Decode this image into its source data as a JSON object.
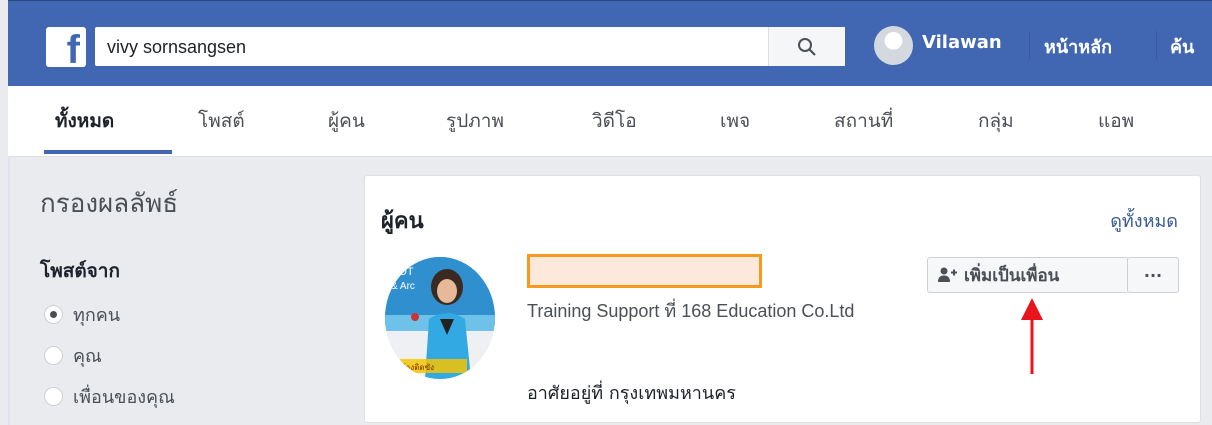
{
  "header": {
    "logo_letter": "f",
    "search_value": "vivy sornsangsen",
    "user_name": "Vilawan",
    "home_label": "หน้าหลัก",
    "find_label": "ค้น"
  },
  "tabs": [
    {
      "label": "ทั้งหมด",
      "active": true
    },
    {
      "label": "โพสต์"
    },
    {
      "label": "ผู้คน"
    },
    {
      "label": "รูปภาพ"
    },
    {
      "label": "วิดีโอ"
    },
    {
      "label": "เพจ"
    },
    {
      "label": "สถานที่"
    },
    {
      "label": "กลุ่ม"
    },
    {
      "label": "แอพ"
    }
  ],
  "filters": {
    "title": "กรองผลลัพธ์",
    "posts_from": "โพสต์จาก",
    "options": [
      {
        "label": "ทุกคน",
        "checked": true
      },
      {
        "label": "คุณ",
        "checked": false
      },
      {
        "label": "เพื่อนของคุณ",
        "checked": false
      }
    ]
  },
  "people_card": {
    "title": "ผู้คน",
    "see_all": "ดูทั้งหมด",
    "job": "Training Support ที่ 168 Education Co.Ltd",
    "lives_in": "อาศัยอยู่ที่ กรุงเทพมหานคร",
    "add_friend_label": "เพิ่มเป็นเพื่อน",
    "more_label": "···",
    "photo_text_top": "BOT",
    "photo_text_mid": "& Arc",
    "photo_caption": "นั่งช้างติดขัง"
  },
  "colors": {
    "fb_blue": "#4267b2",
    "highlight_fill": "#fde9dc",
    "highlight_border": "#f59a1d",
    "arrow": "#e8141b"
  }
}
